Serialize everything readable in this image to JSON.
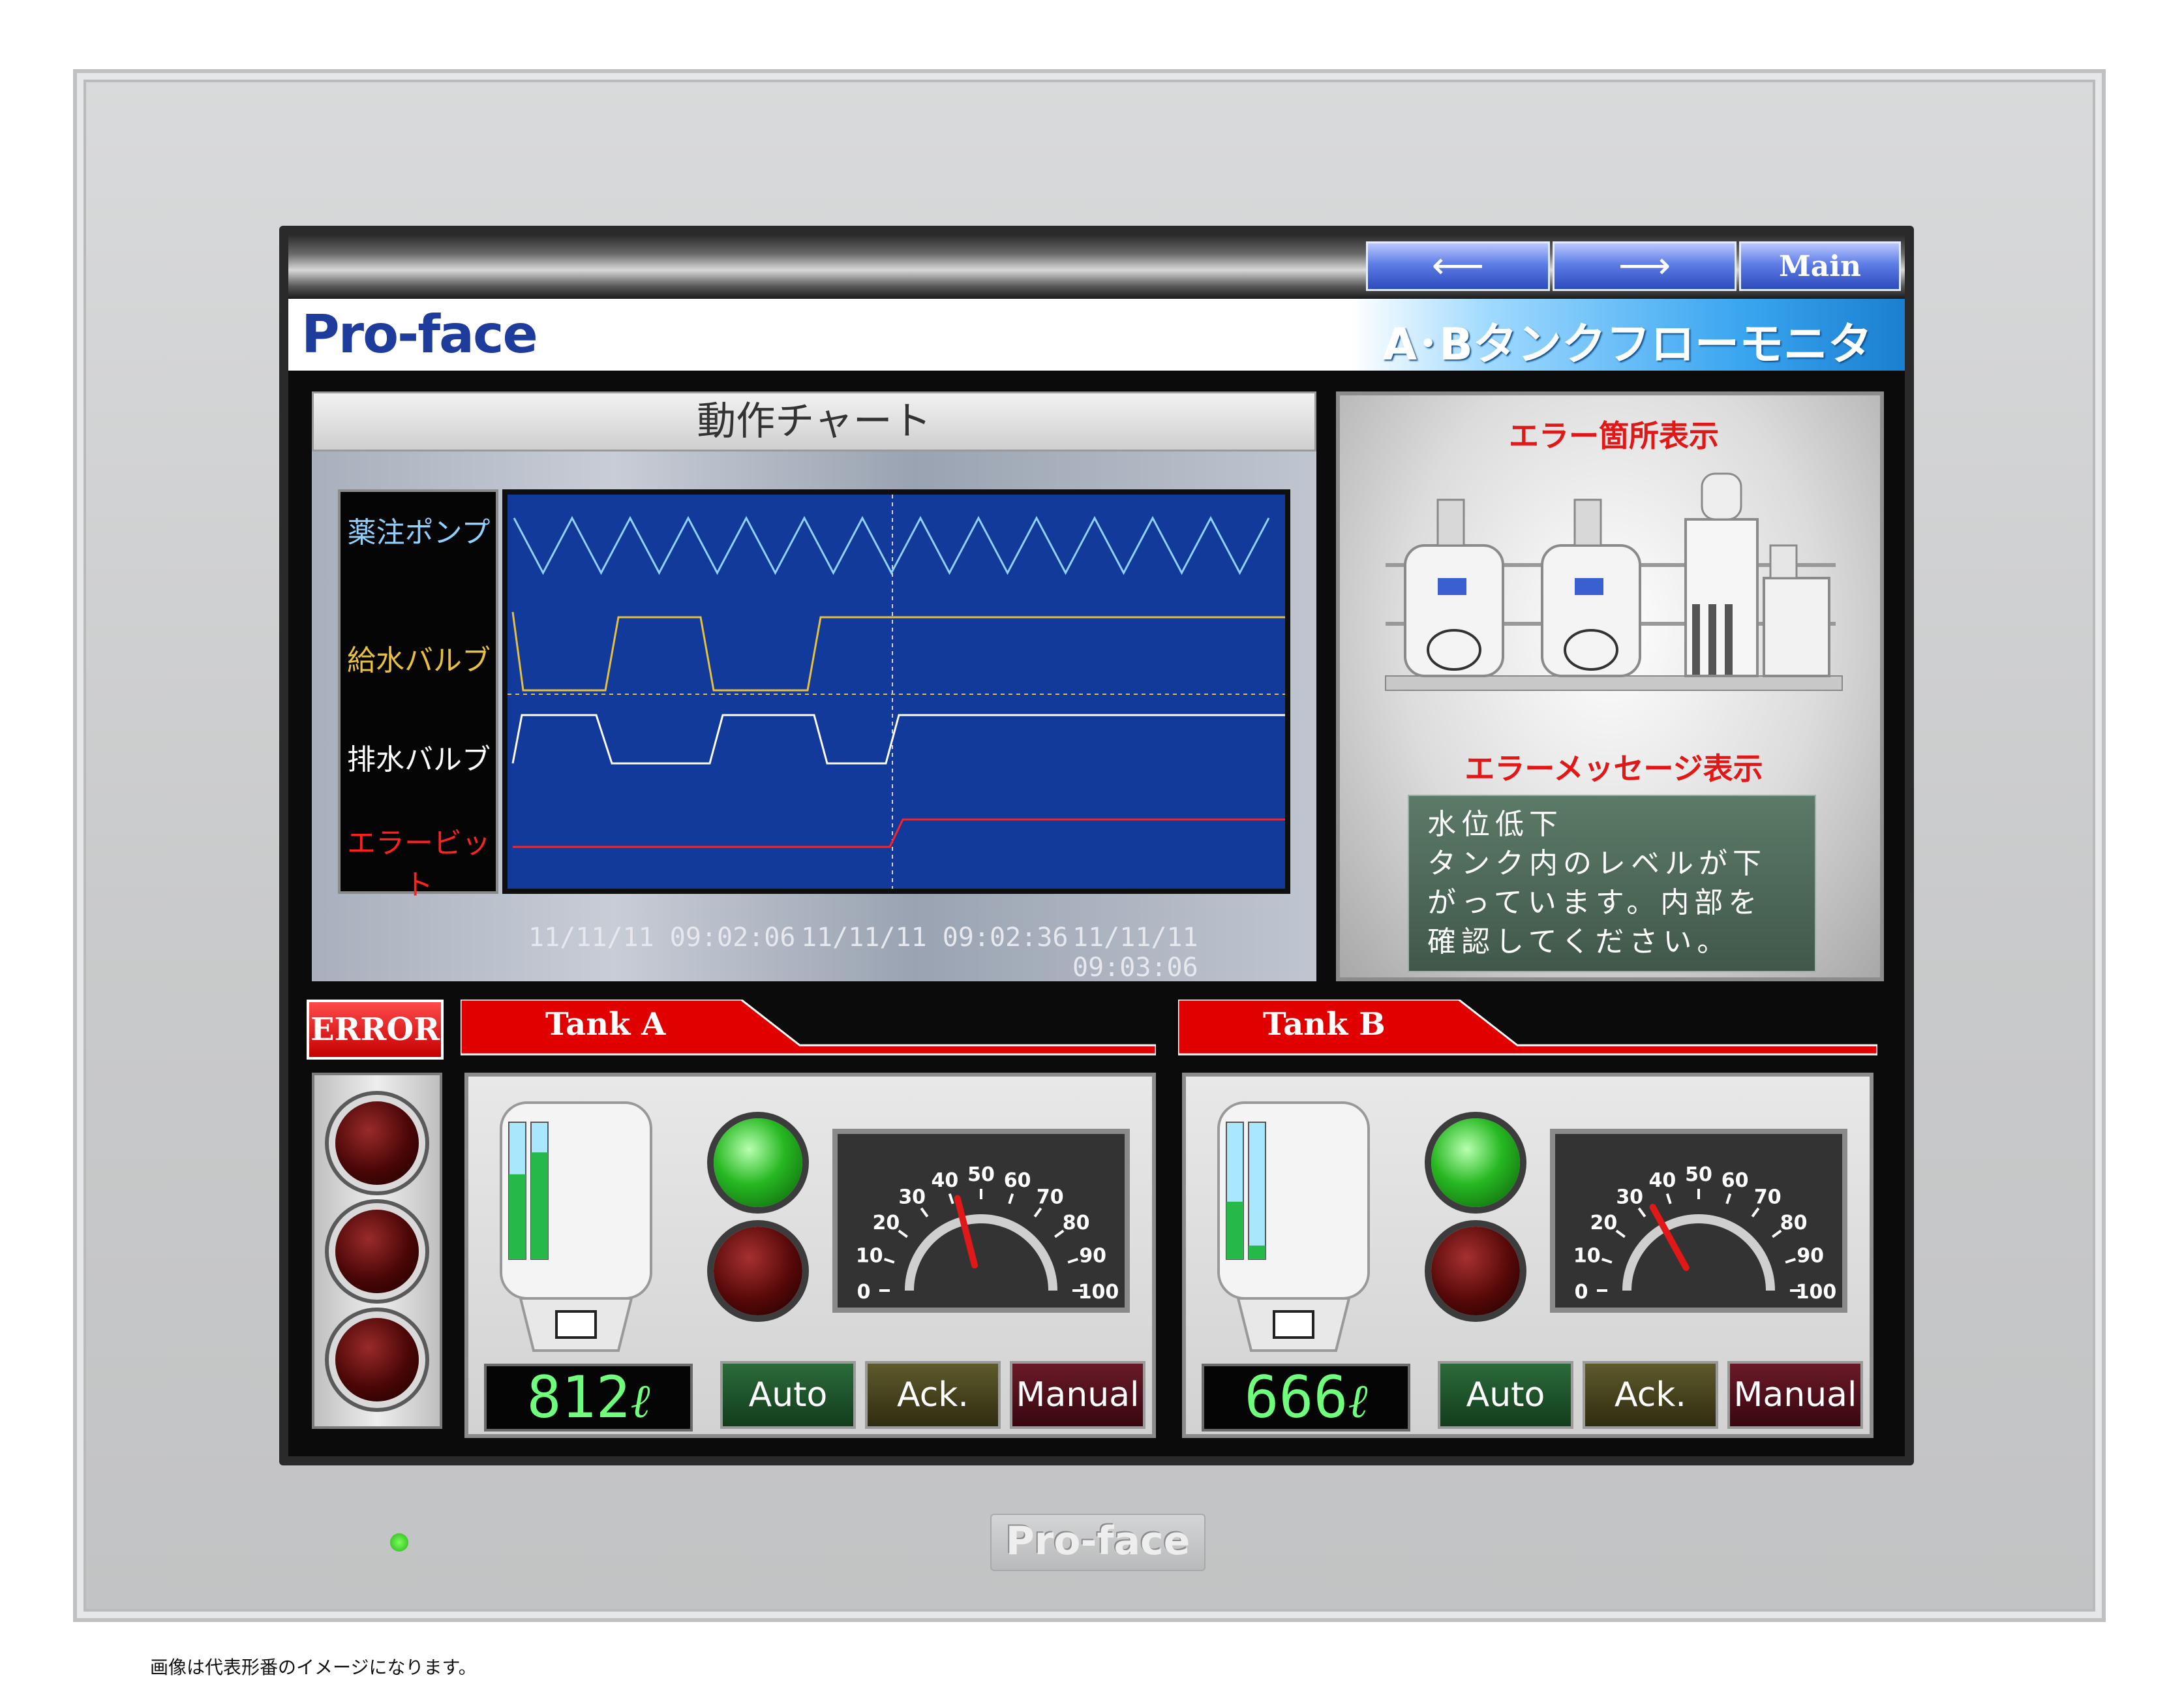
{
  "nav": {
    "back_arrow": "⟵",
    "forward_arrow": "⟶",
    "main_label": "Main"
  },
  "header": {
    "logo": "Pro-face",
    "title": "A･Bタンクフローモニタ"
  },
  "chart": {
    "title": "動作チャート",
    "signals": [
      {
        "label": "薬注ポンプ",
        "color": "#8fd0ff"
      },
      {
        "label": "給水バルブ",
        "color": "#e8c040"
      },
      {
        "label": "排水バルブ",
        "color": "#ffffff"
      },
      {
        "label": "エラービット",
        "color": "#ff2020"
      }
    ],
    "timestamps": [
      "11/11/11 09:02:06",
      "11/11/11 09:02:36",
      "11/11/11 09:03:06"
    ]
  },
  "error_panel": {
    "location_title": "エラー箇所表示",
    "message_title": "エラーメッセージ表示",
    "message_lines": [
      "水位低下",
      "タンク内のレベルが下",
      "がっています。内部を",
      "確認してください。"
    ]
  },
  "error_tab": {
    "label": "ERROR"
  },
  "tanks": [
    {
      "name": "Tank A",
      "volume": "812",
      "unit": "ℓ",
      "gauge_value": 42,
      "level_a": 0.62,
      "level_b": 0.78
    },
    {
      "name": "Tank B",
      "volume": "666",
      "unit": "ℓ",
      "gauge_value": 34,
      "level_a": 0.42,
      "level_b": 0.1
    }
  ],
  "gauge": {
    "ticks": [
      "0",
      "10",
      "20",
      "30",
      "40",
      "50",
      "60",
      "70",
      "80",
      "90",
      "100"
    ],
    "max": 100
  },
  "buttons": {
    "auto": "Auto",
    "ack": "Ack.",
    "manual": "Manual"
  },
  "bezel": {
    "logo": "Pro-face"
  },
  "footnote": "画像は代表形番のイメージになります。",
  "colors": {
    "accent_red": "#d80000",
    "title_blue": "#1d3c9c",
    "plot_bg": "#123a9a"
  }
}
